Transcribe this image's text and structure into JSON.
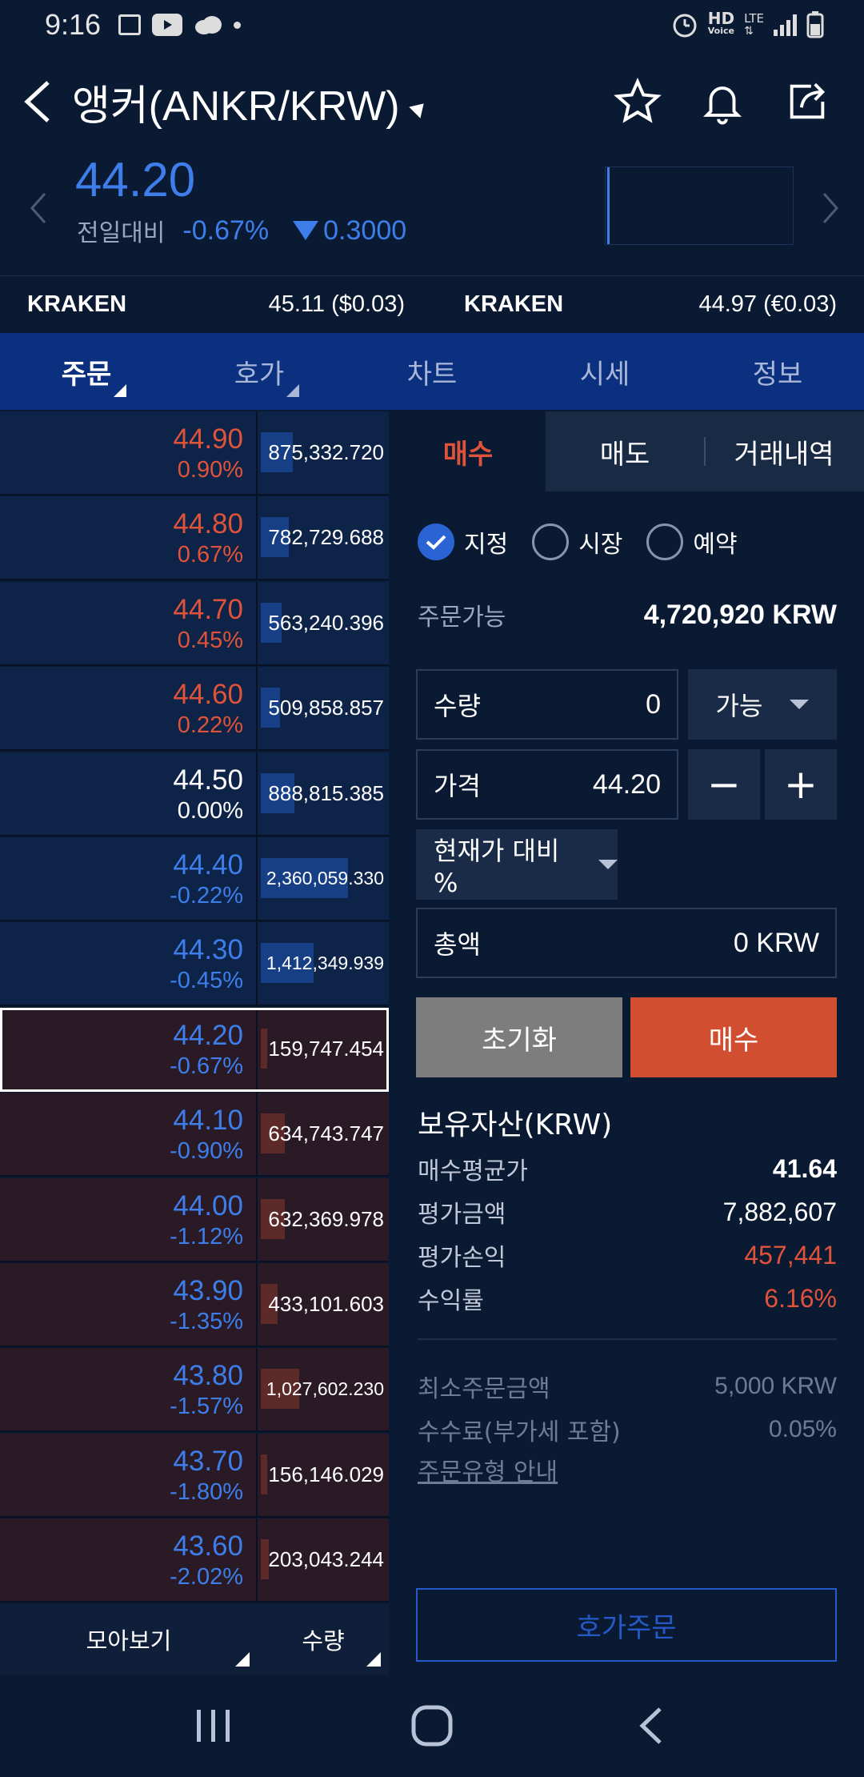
{
  "status": {
    "time": "9:16",
    "hd": "HD",
    "voice": "Voice",
    "lte": "LTE"
  },
  "header": {
    "title": "앵커(ANKR/KRW)"
  },
  "price": {
    "current": "44.20",
    "change_label": "전일대비",
    "change_pct": "-0.67%",
    "change_amt": "0.3000"
  },
  "kraken": [
    {
      "name": "KRAKEN",
      "value": "45.11 ($0.03)"
    },
    {
      "name": "KRAKEN",
      "value": "44.97 (€0.03)"
    }
  ],
  "tabs": [
    "주문",
    "호가",
    "차트",
    "시세",
    "정보"
  ],
  "orderbook": {
    "rows": [
      {
        "price": "44.90",
        "change": "0.90%",
        "qty": "875,332.720",
        "side": "ask",
        "color": "up",
        "bar": 0.25
      },
      {
        "price": "44.80",
        "change": "0.67%",
        "qty": "782,729.688",
        "side": "ask",
        "color": "up",
        "bar": 0.22
      },
      {
        "price": "44.70",
        "change": "0.45%",
        "qty": "563,240.396",
        "side": "ask",
        "color": "up",
        "bar": 0.16
      },
      {
        "price": "44.60",
        "change": "0.22%",
        "qty": "509,858.857",
        "side": "ask",
        "color": "up",
        "bar": 0.15
      },
      {
        "price": "44.50",
        "change": "0.00%",
        "qty": "888,815.385",
        "side": "ask",
        "color": "flat",
        "bar": 0.26
      },
      {
        "price": "44.40",
        "change": "-0.22%",
        "qty": "2,360,059.330",
        "side": "ask",
        "color": "dn",
        "bar": 0.68
      },
      {
        "price": "44.30",
        "change": "-0.45%",
        "qty": "1,412,349.939",
        "side": "ask",
        "color": "dn",
        "bar": 0.41
      },
      {
        "price": "44.20",
        "change": "-0.67%",
        "qty": "159,747.454",
        "side": "bid",
        "color": "dn",
        "bar": 0.05,
        "current": true
      },
      {
        "price": "44.10",
        "change": "-0.90%",
        "qty": "634,743.747",
        "side": "bid",
        "color": "dn",
        "bar": 0.19
      },
      {
        "price": "44.00",
        "change": "-1.12%",
        "qty": "632,369.978",
        "side": "bid",
        "color": "dn",
        "bar": 0.19
      },
      {
        "price": "43.90",
        "change": "-1.35%",
        "qty": "433,101.603",
        "side": "bid",
        "color": "dn",
        "bar": 0.13
      },
      {
        "price": "43.80",
        "change": "-1.57%",
        "qty": "1,027,602.230",
        "side": "bid",
        "color": "dn",
        "bar": 0.3
      },
      {
        "price": "43.70",
        "change": "-1.80%",
        "qty": "156,146.029",
        "side": "bid",
        "color": "dn",
        "bar": 0.05
      },
      {
        "price": "43.60",
        "change": "-2.02%",
        "qty": "203,043.244",
        "side": "bid",
        "color": "dn",
        "bar": 0.06
      }
    ],
    "footer": {
      "view_label": "모아보기",
      "qty_label": "수량"
    }
  },
  "order": {
    "subtabs": [
      "매수",
      "매도",
      "거래내역"
    ],
    "radios": [
      "지정",
      "시장",
      "예약"
    ],
    "available_label": "주문가능",
    "available_value": "4,720,920 KRW",
    "qty_label": "수량",
    "qty_value": "0",
    "qty_dropdown": "가능",
    "price_label": "가격",
    "price_value": "44.20",
    "minus": "−",
    "plus": "+",
    "pct_dropdown": "현재가 대비 %",
    "total_label": "총액",
    "total_value": "0 KRW",
    "reset_label": "초기화",
    "buy_label": "매수"
  },
  "holdings": {
    "title": "보유자산(KRW)",
    "rows": [
      {
        "label": "매수평균가",
        "value": "41.64",
        "color": "#ffffff",
        "bold": true
      },
      {
        "label": "평가금액",
        "value": "7,882,607",
        "color": "#ffffff"
      },
      {
        "label": "평가손익",
        "value": "457,441",
        "color": "#e0533b"
      },
      {
        "label": "수익률",
        "value": "6.16%",
        "color": "#e0533b"
      }
    ]
  },
  "info": {
    "min_order_label": "최소주문금액",
    "min_order_value": "5,000 KRW",
    "fee_label": "수수료(부가세 포함)",
    "fee_value": "0.05%",
    "guide_link": "주문유형 안내",
    "hoga_button": "호가주문"
  },
  "colors": {
    "up": "#e0533b",
    "down": "#3d7eea",
    "tabbar": "#0c3080"
  }
}
